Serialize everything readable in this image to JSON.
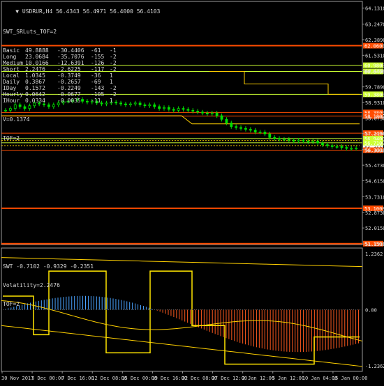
{
  "chart_data": [
    {
      "type": "candlestick",
      "title": "USDRUR,H4",
      "ohlc_header": "56.4343 56.4971 56.4000 56.4103",
      "ylim": [
        51.1,
        64.5
      ],
      "y_ticks": [
        64.131,
        63.247,
        62.389,
        61.531,
        60.673,
        59.789,
        58.931,
        58.073,
        57.215,
        56.331,
        55.473,
        54.615,
        53.731,
        52.873,
        52.015,
        51.131
      ],
      "x_labels": [
        "30 Nov 2017",
        "5 Dec 00:00",
        "7 Dec 16:00",
        "12 Dec 08:00",
        "15 Dec 00:00",
        "19 Dec 16:00",
        "22 Dec 08:00",
        "27 Dec 12:00",
        "2 Jan 12:00",
        "5 Jan 12:00",
        "10 Jan 04:00",
        "15 Jan 00:00"
      ],
      "indicator": {
        "name": "SWT_SRLuts_TOF=2",
        "rows": [
          [
            "Basic",
            "49.8888",
            "-30.4406",
            "-61",
            "-1"
          ],
          [
            "Long",
            "23.0684",
            "-35.7076",
            "-155",
            "-2"
          ],
          [
            "Medium",
            "10.0166",
            "-12.6391",
            "-126",
            "-2"
          ],
          [
            "Short",
            "2.2476",
            "-2.6225",
            "-117",
            "-2"
          ],
          [
            "Local",
            "1.0345",
            "-0.3749",
            "-36",
            "1"
          ],
          [
            "Daily",
            "0.3867",
            "-0.2657",
            "-69",
            "1"
          ],
          [
            "IDay",
            "0.1572",
            "-0.2249",
            "-143",
            "-2"
          ],
          [
            "Hourly",
            "0.0642",
            "-0.0677",
            "-105",
            "-2"
          ],
          [
            "IHour",
            "0.0334",
            "-0.0035",
            "-11",
            "1"
          ]
        ],
        "v_line": "V=0.1374",
        "tof_line": "TOF=2"
      },
      "levels": [
        {
          "price": 62.06,
          "label": "62.0600",
          "color": "#ff4d00"
        },
        {
          "price": 60.98,
          "label": "60.9800",
          "color": "#ccff33"
        },
        {
          "price": 60.64,
          "label": "60.6400",
          "color": "#ccff33"
        },
        {
          "price": 59.38,
          "label": "59.3800",
          "color": "#ccff33"
        },
        {
          "price": 58.38,
          "label": "58.3800",
          "color": "#ff4d00"
        },
        {
          "price": 58.18,
          "label": "58.1800",
          "color": "#ff4d00"
        },
        {
          "price": 57.24,
          "label": "57.2400",
          "color": "#ff4d00"
        },
        {
          "price": 56.94,
          "label": "56.9400",
          "color": "#ccff33"
        },
        {
          "price": 56.71,
          "label": "56.7100",
          "color": "#ccff33"
        },
        {
          "price": 56.4103,
          "label": "56.4103",
          "color": "#ffffff"
        },
        {
          "price": 56.3,
          "label": "56.3000",
          "color": "#ff4d00"
        },
        {
          "price": 53.1,
          "label": "53.1000",
          "color": "#ff4d00"
        },
        {
          "price": 51.15,
          "label": "51.1500",
          "color": "#ff4d00"
        }
      ],
      "close_series": [
        58.5,
        58.6,
        58.8,
        58.7,
        58.6,
        58.75,
        58.9,
        58.85,
        58.8,
        58.7,
        58.8,
        58.9,
        59.0,
        59.0,
        59.05,
        59.1,
        59.0,
        58.95,
        59.0,
        58.9,
        58.85,
        58.9,
        58.95,
        58.9,
        58.85,
        58.8,
        58.85,
        58.9,
        58.8,
        58.75,
        58.8,
        58.7,
        58.6,
        58.65,
        58.55,
        58.5,
        58.6,
        58.55,
        58.5,
        58.45,
        58.4,
        58.35,
        58.3,
        58.35,
        58.2,
        58.0,
        57.8,
        57.6,
        57.55,
        57.5,
        57.45,
        57.4,
        57.3,
        57.3,
        57.2,
        57.0,
        56.95,
        56.9,
        56.9,
        56.85,
        56.8,
        56.85,
        56.8,
        56.75,
        56.8,
        56.7,
        56.6,
        56.55,
        56.5,
        56.5,
        56.45,
        56.4,
        56.4,
        56.41
      ]
    },
    {
      "type": "oscillator",
      "title": "SWT",
      "values_header": "-0.7102 -0.9329 -0.2351",
      "volatility_line": "Volatility=2.2476",
      "tof_line": "TOF=2",
      "ylim": [
        -1.2362,
        1.2362
      ],
      "y_ticks": [
        "1.2362",
        "0.00",
        "-1.2362"
      ]
    }
  ]
}
